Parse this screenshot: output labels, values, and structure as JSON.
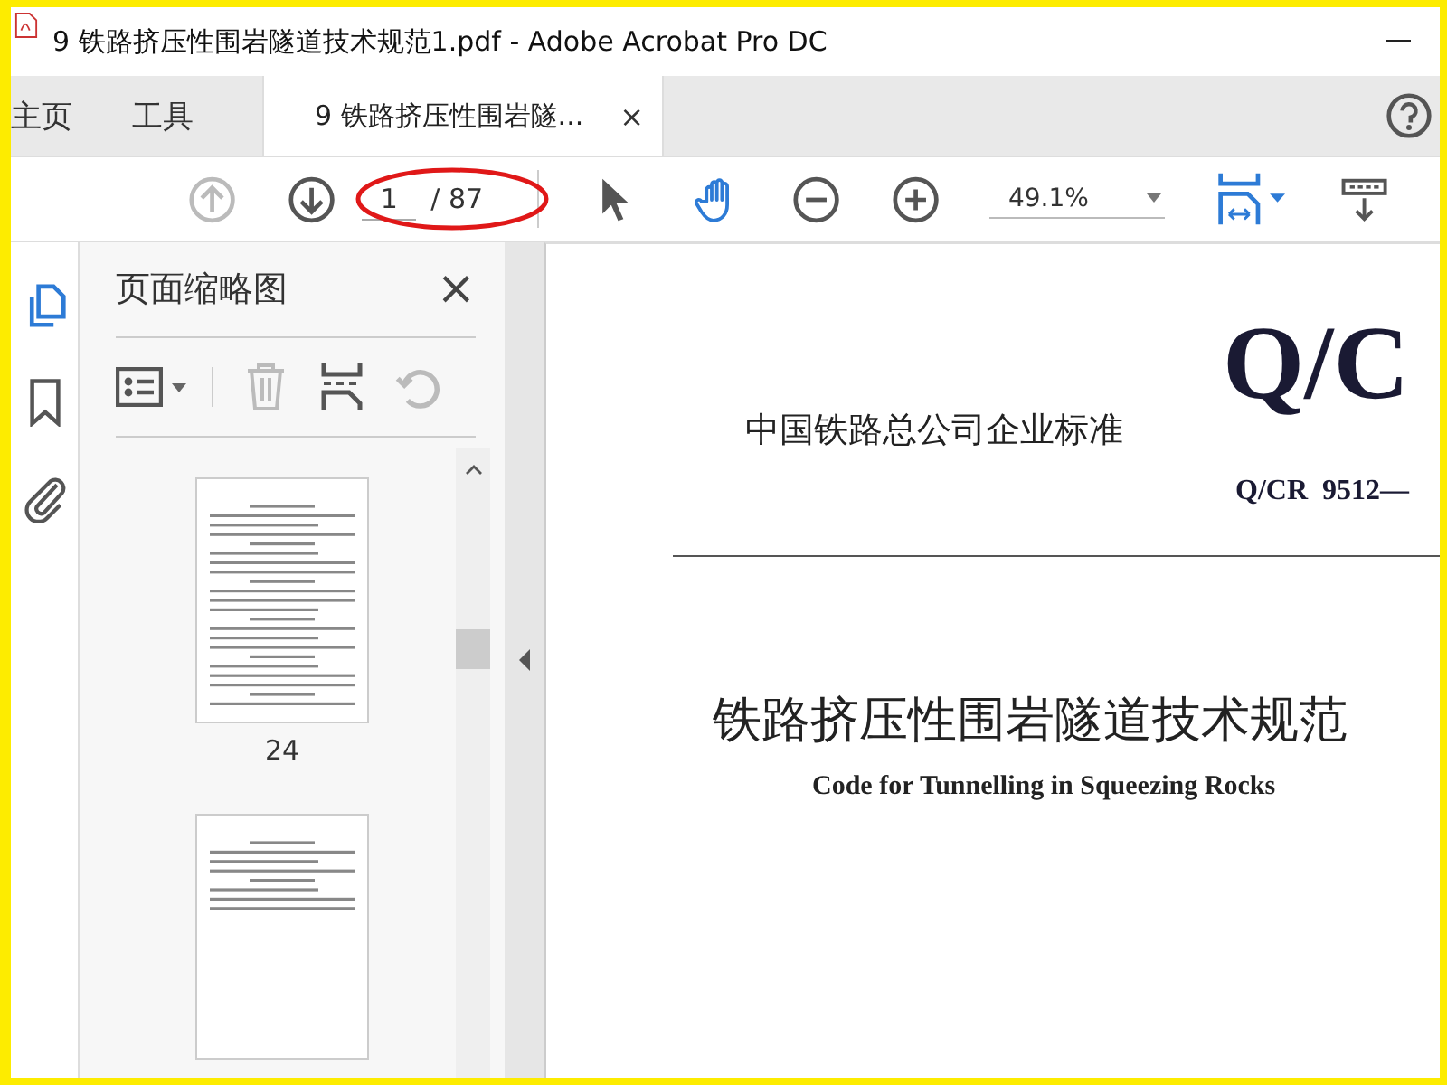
{
  "window": {
    "title": "9 铁路挤压性围岩隧道技术规范1.pdf - Adobe Acrobat Pro DC"
  },
  "tabs": [
    {
      "label": "主页",
      "kind": "nav",
      "selected": false
    },
    {
      "label": "工具",
      "kind": "nav",
      "selected": false
    },
    {
      "label": "9 铁路挤压性围岩隧...",
      "kind": "document",
      "selected": true,
      "close": "×"
    }
  ],
  "toolbar": {
    "prev_page": {
      "disabled": true
    },
    "next_page": {
      "disabled": false
    },
    "page_input": {
      "value": "1"
    },
    "page_total": "/ 87",
    "tools": [
      {
        "kind": "select",
        "selected": false
      },
      {
        "kind": "hand",
        "selected": true
      }
    ],
    "zoom": "49.1%"
  },
  "rail": [
    {
      "kind": "pages",
      "selected": true
    },
    {
      "kind": "bookmark",
      "selected": false
    },
    {
      "kind": "attachment",
      "selected": false
    }
  ],
  "panel": {
    "title": "页面缩略图",
    "close": "×",
    "actions": [
      {
        "kind": "options",
        "disabled": false
      },
      {
        "kind": "delete",
        "disabled": true
      },
      {
        "kind": "insert",
        "disabled": false
      },
      {
        "kind": "undo",
        "disabled": true
      }
    ],
    "thumbnails": [
      {
        "kind": "full-text",
        "label": "24"
      },
      {
        "kind": "partial-text"
      }
    ]
  },
  "document": {
    "code_big": "Q/C",
    "org": "中国铁路总公司企业标准",
    "code": "Q/CR  9512—",
    "title": "铁路挤压性围岩隧道技术规范",
    "subtitle": "Code for Tunnelling in Squeezing Rocks"
  }
}
